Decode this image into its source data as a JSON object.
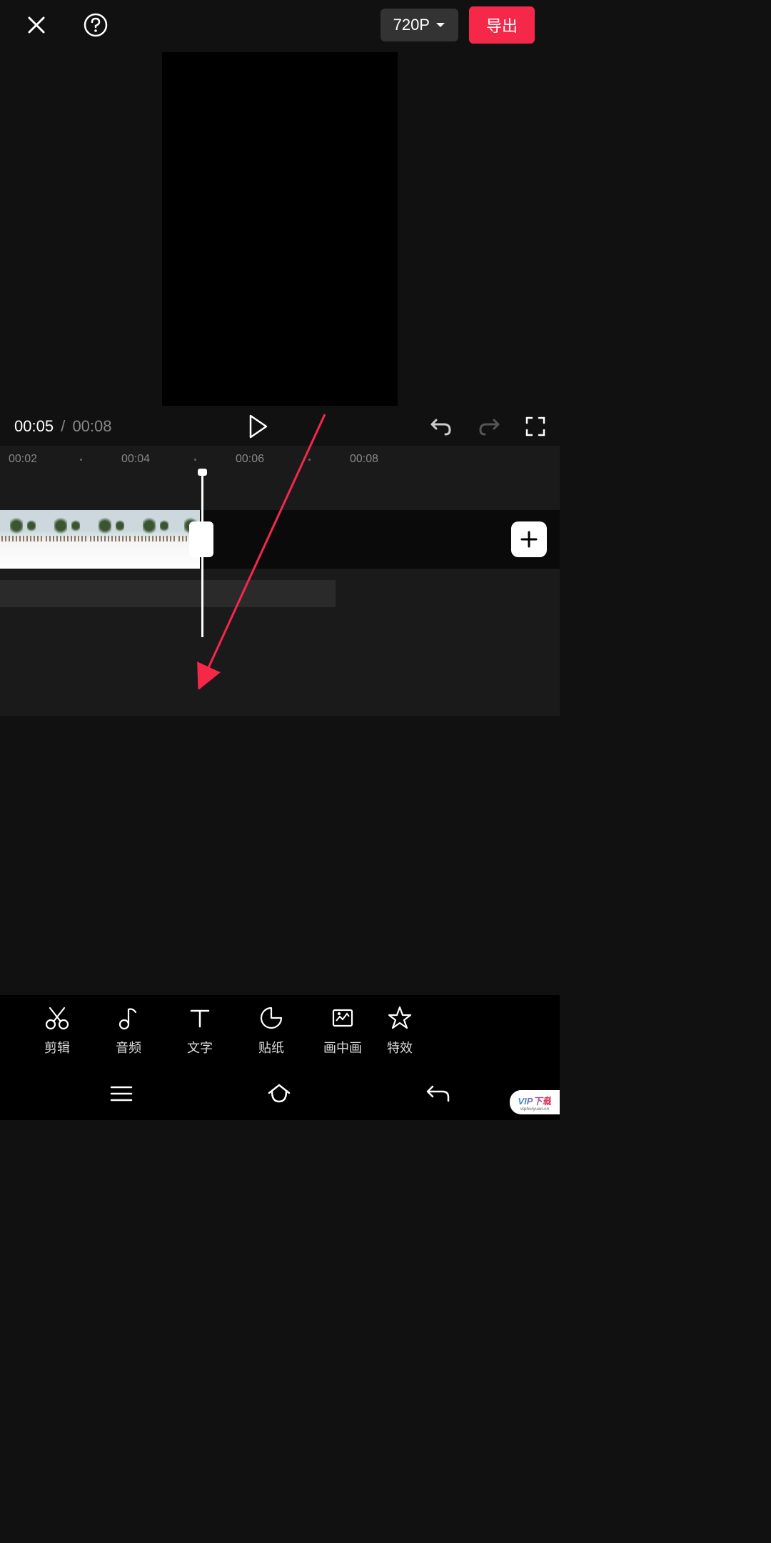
{
  "header": {
    "resolution_label": "720P",
    "export_label": "导出"
  },
  "playback": {
    "current_time": "00:05",
    "total_time": "00:08",
    "separator": "/"
  },
  "ruler": {
    "marks": [
      "00:02",
      "00:04",
      "00:06",
      "00:08"
    ]
  },
  "toolbar": {
    "items": [
      {
        "label": "剪辑",
        "icon": "scissors"
      },
      {
        "label": "音频",
        "icon": "music"
      },
      {
        "label": "文字",
        "icon": "text"
      },
      {
        "label": "贴纸",
        "icon": "sticker"
      },
      {
        "label": "画中画",
        "icon": "pip"
      },
      {
        "label": "特效",
        "icon": "star"
      }
    ]
  },
  "watermark": {
    "brand": "VIP下载",
    "site": "viphuiyuan.cn"
  },
  "colors": {
    "accent": "#f5284a",
    "bg": "#111"
  }
}
